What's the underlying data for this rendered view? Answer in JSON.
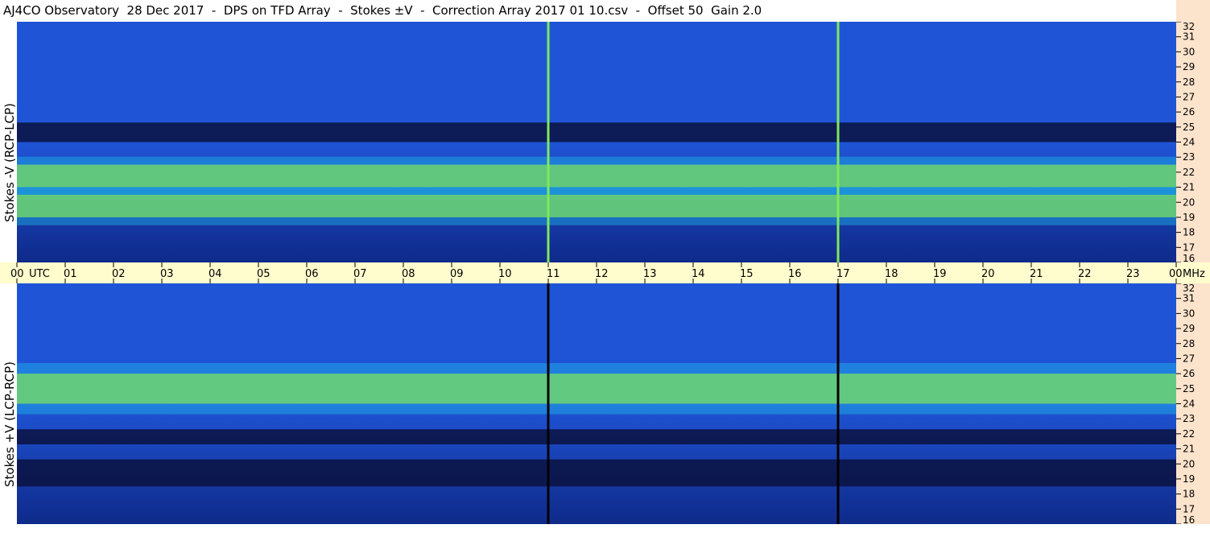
{
  "title": "AJ4CO Observatory  28 Dec 2017  -  DPS on TFD Array  -  Stokes ±V  -  Correction Array 2017 01 10.csv  -  Offset 50  Gain 2.0",
  "chart_data": [
    {
      "type": "heatmap",
      "panel": "top",
      "ylabel": "Stokes -V (RCP-LCP)",
      "y_axis": {
        "unit": "MHz",
        "range": [
          16,
          32
        ],
        "ticks": [
          "32",
          "31",
          "30",
          "29",
          "28",
          "27",
          "26",
          "25",
          "24",
          "23",
          "22",
          "21",
          "20",
          "19",
          "18",
          "17",
          "16"
        ]
      },
      "x_axis": {
        "range_hours": [
          0,
          24
        ]
      },
      "bands": [
        {
          "mhz_from": 24.0,
          "mhz_to": 25.3,
          "level": "dark"
        },
        {
          "mhz_from": 21.0,
          "mhz_to": 22.5,
          "level": "bright"
        },
        {
          "mhz_from": 19.0,
          "mhz_to": 20.5,
          "level": "bright"
        }
      ],
      "vertical_lines_hours": [
        11.0,
        17.0
      ],
      "vertical_line_level": "bright"
    },
    {
      "type": "heatmap",
      "panel": "bottom",
      "ylabel": "Stokes +V (LCP-RCP)",
      "y_axis": {
        "unit": "MHz",
        "range": [
          16,
          32
        ],
        "ticks": [
          "32",
          "31",
          "30",
          "29",
          "28",
          "27",
          "26",
          "25",
          "24",
          "23",
          "22",
          "21",
          "20",
          "19",
          "18",
          "17",
          "16"
        ]
      },
      "x_axis": {
        "range_hours": [
          0,
          24
        ]
      },
      "bands": [
        {
          "mhz_from": 24.0,
          "mhz_to": 26.0,
          "level": "bright"
        },
        {
          "mhz_from": 21.3,
          "mhz_to": 22.3,
          "level": "dark"
        },
        {
          "mhz_from": 18.5,
          "mhz_to": 20.3,
          "level": "dark"
        }
      ],
      "vertical_lines_hours": [
        11.0,
        17.0
      ],
      "vertical_line_level": "black"
    }
  ],
  "time_axis": {
    "labels": [
      "00",
      "01",
      "02",
      "03",
      "04",
      "05",
      "06",
      "07",
      "08",
      "09",
      "10",
      "11",
      "12",
      "13",
      "14",
      "15",
      "16",
      "17",
      "18",
      "19",
      "20",
      "21",
      "22",
      "23",
      "00"
    ],
    "utc_label": "UTC",
    "unit_label": "MHz"
  },
  "colors": {
    "background_blue": "#1f54d6",
    "deep_blue": "#0f2a8a",
    "dark_navy": "#0a1240",
    "cyan": "#1fb6e6",
    "bright_green": "#7fe85a",
    "time_bar": "#fffccd",
    "freq_strip": "#fce3cc"
  }
}
